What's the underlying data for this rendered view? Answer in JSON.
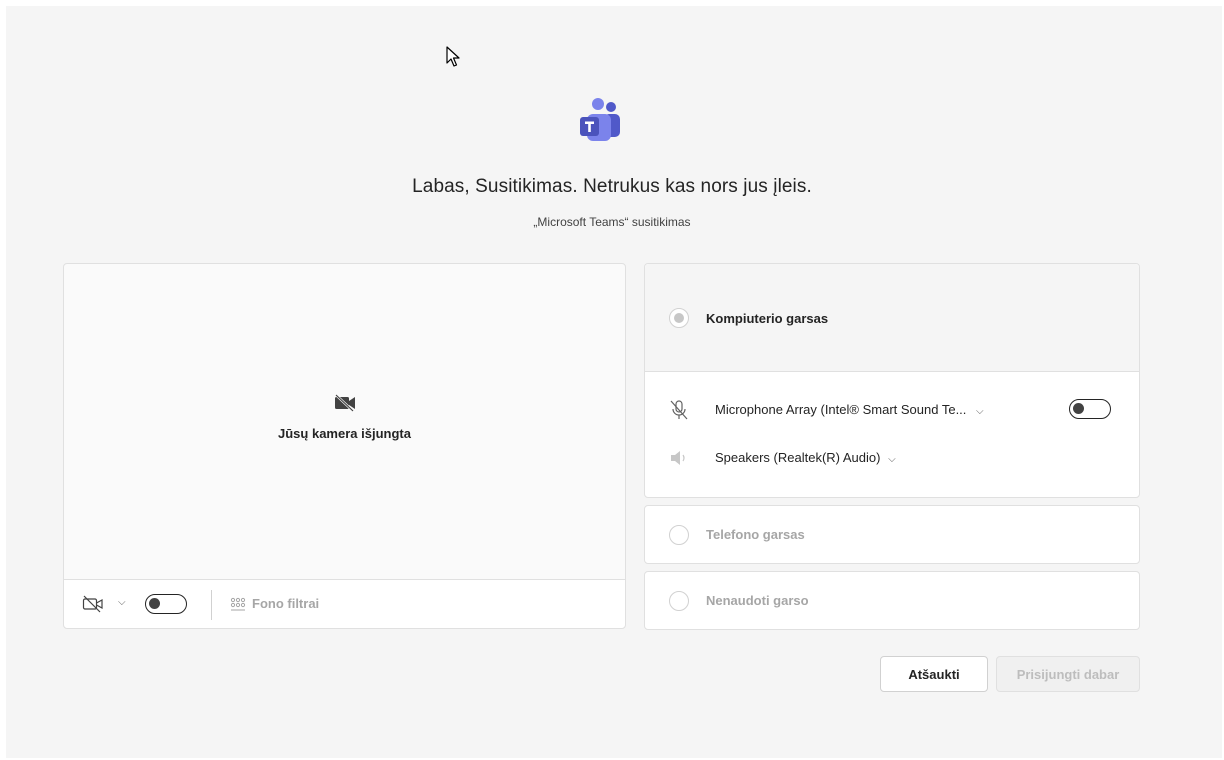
{
  "header": {
    "title": "Labas, Susitikimas. Netrukus kas nors jus įleis.",
    "subtitle": "„Microsoft Teams“ susitikimas"
  },
  "video": {
    "status": "Jūsų kamera išjungta",
    "camera_toggle": "off",
    "background_filters_label": "Fono filtrai"
  },
  "audio": {
    "computer_audio": {
      "label": "Kompiuterio garsas",
      "selected": true,
      "microphone": "Microphone Array (Intel® Smart Sound Te...",
      "microphone_toggle": "off",
      "speakers": "Speakers (Realtek(R) Audio)"
    },
    "phone_audio": {
      "label": "Telefono garsas",
      "selected": false
    },
    "no_audio": {
      "label": "Nenaudoti garso",
      "selected": false
    }
  },
  "buttons": {
    "cancel": "Atšaukti",
    "join": "Prisijungti dabar"
  },
  "icons": {
    "logo": "microsoft-teams-logo",
    "camera_off": "video-off-icon",
    "mic_off": "mic-off-icon",
    "speaker": "speaker-icon"
  },
  "colors": {
    "teams_purple": "#5b5fc7",
    "background": "#f5f5f5",
    "disabled_text": "#a6a6a6"
  }
}
